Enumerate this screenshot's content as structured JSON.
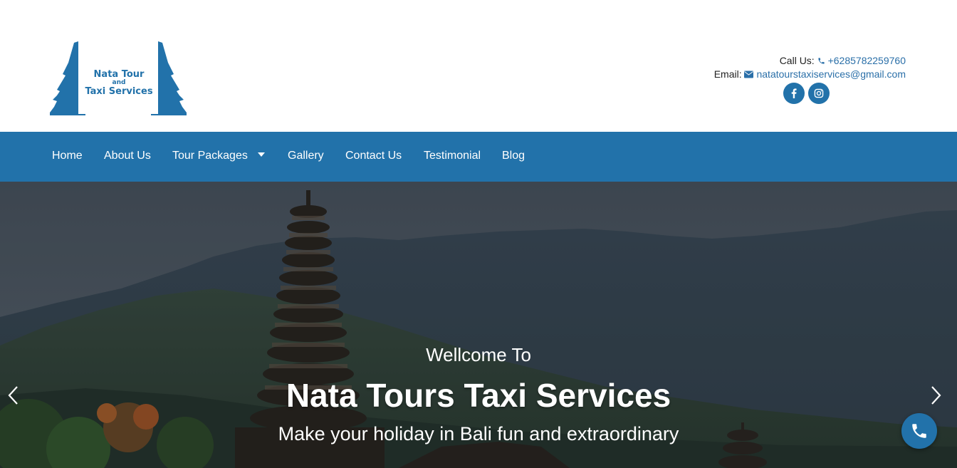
{
  "logo": {
    "line1": "Nata Tour",
    "line2": "and",
    "line3": "Taxi Services"
  },
  "contact": {
    "call_label": "Call Us:",
    "phone": "+6285782259760",
    "email_label": "Email:",
    "email": "natatourstaxiservices@gmail.com",
    "icons": [
      "phone-icon",
      "envelope-icon"
    ]
  },
  "socials": [
    "facebook-icon",
    "instagram-icon"
  ],
  "nav": {
    "items": [
      "Home",
      "About Us",
      "Tour Packages",
      "Gallery",
      "Contact Us",
      "Testimonial",
      "Blog"
    ]
  },
  "hero": {
    "subtitle": "Wellcome To",
    "title": "Nata Tours Taxi Services",
    "tagline": "Make your holiday in Bali fun and extraordinary"
  },
  "colors": {
    "brand": "#2272aa",
    "link": "#2a6fa8",
    "nav_text": "#ffffff"
  },
  "float_button_icon": "phone-icon"
}
